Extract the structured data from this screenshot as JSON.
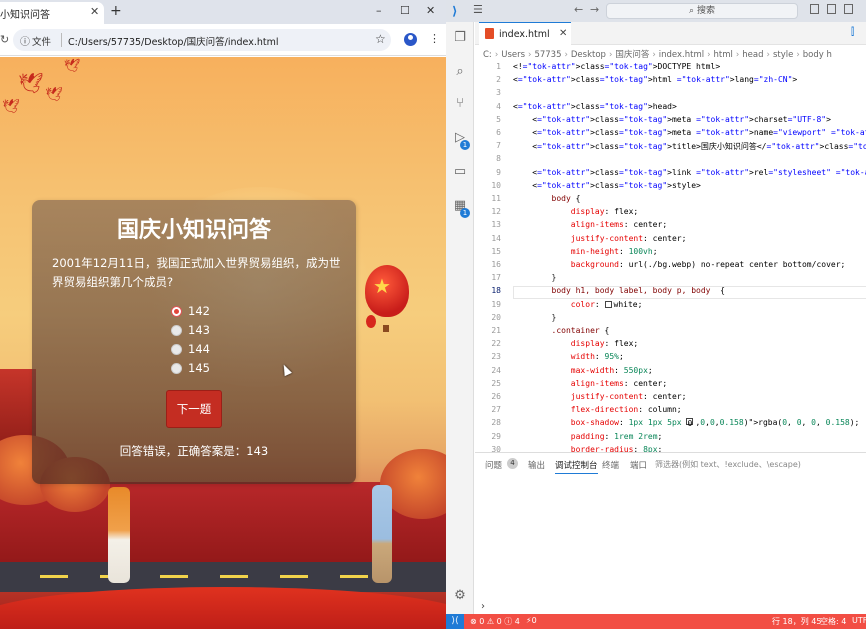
{
  "browser": {
    "tab_title": "小知识问答",
    "tab_close": "✕",
    "new_tab": "+",
    "win_minimize": "–",
    "win_maximize": "☐",
    "win_close": "✕",
    "address_scheme": "文件",
    "address_url": "C:/Users/57735/Desktop/国庆问答/index.html"
  },
  "quiz": {
    "title": "国庆小知识问答",
    "question": "2001年12月11日，我国正式加入世界贸易组织，成为世界贸易组织第几个成员?",
    "options": [
      {
        "label": "142",
        "checked": true
      },
      {
        "label": "143",
        "checked": false
      },
      {
        "label": "144",
        "checked": false
      },
      {
        "label": "145",
        "checked": false
      }
    ],
    "next_button": "下一题",
    "result": "回答错误，正确答案是：143"
  },
  "vscode": {
    "search_placeholder": "搜索",
    "editor_tab": "index.html",
    "breadcrumb": [
      "C:",
      "Users",
      "57735",
      "Desktop",
      "国庆问答",
      "index.html",
      "html",
      "head",
      "style",
      "body h"
    ],
    "code_lines": [
      "<!DOCTYPE html>",
      "<html lang=\"zh-CN\">",
      "",
      "<head>",
      "    <meta charset=\"UTF-8\">",
      "    <meta name=\"viewport\" content=\"width=device-width, initial-scale=1.0\">",
      "    <title>国庆小知识问答</title>",
      "",
      "    <link rel=\"stylesheet\" href=\"./style.css\">",
      "    <style>",
      "        body {",
      "            display: flex;",
      "            align-items: center;",
      "            justify-content: center;",
      "            min-height: 100vh;",
      "            background: url(./bg.webp) no-repeat center bottom/cover;",
      "        }",
      "        body h1, body label, body p, body  {",
      "            color: white;",
      "        }",
      "        .container {",
      "            display: flex;",
      "            width: 95%;",
      "            max-width: 550px;",
      "            align-items: center;",
      "            justify-content: center;",
      "            flex-direction: column;",
      "            box-shadow: 1px 1px 5px rgba(0, 0, 0, 0.158);",
      "            padding: 1rem 2rem;",
      "            border-radius: 8px;"
    ],
    "active_line": 18,
    "panel_tabs": [
      "问题",
      "输出",
      "调试控制台",
      "终端",
      "端口"
    ],
    "problems_count": "4",
    "panel_filter": "筛选器(例如 text、!exclude、\\escape)",
    "status_left": "⊗ 0 ⚠ 0 ⓘ 4",
    "status_ports": "⚡0",
    "status_position": "行 18，列 45",
    "status_spaces": "空格: 4",
    "status_encoding": "UTF"
  }
}
